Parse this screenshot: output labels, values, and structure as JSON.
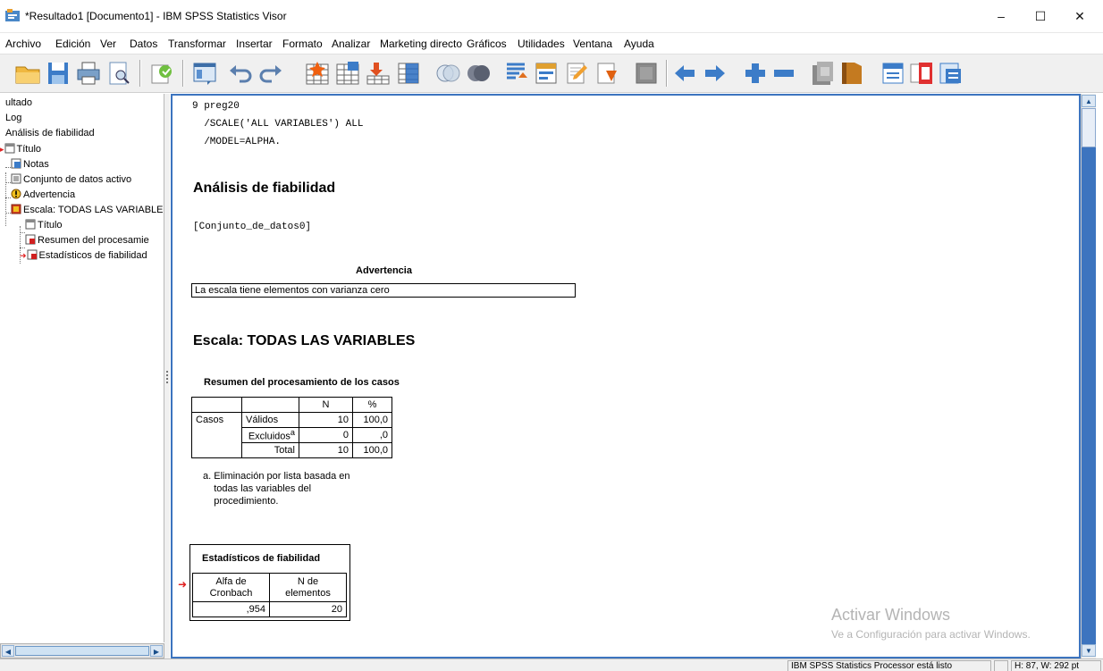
{
  "window": {
    "title": "*Resultado1 [Documento1] - IBM SPSS Statistics Visor",
    "min_glyph": "–",
    "max_glyph": "☐",
    "close_glyph": "✕"
  },
  "menu": [
    "Archivo",
    "Edición",
    "Ver",
    "Datos",
    "Transformar",
    "Insertar",
    "Formato",
    "Analizar",
    "Marketing directo",
    "Gráficos",
    "Utilidades",
    "Ventana",
    "Ayuda"
  ],
  "toolbar_icons": [
    "open-icon",
    "save-icon",
    "print-icon",
    "print-preview-icon",
    "export-icon",
    "recall-dialog-icon",
    "undo-icon",
    "redo-icon",
    "goto-data-icon",
    "goto-case-icon",
    "variables-icon",
    "select-cases-icon",
    "circle-icon",
    "circles-icon",
    "weight-icon",
    "value-labels-icon",
    "designate-window-icon",
    "show-output-icon",
    "hidden-icon",
    "promote-icon",
    "demote-icon",
    "expand-icon",
    "collapse-icon",
    "show-icon",
    "hide-icon",
    "insert-heading-icon",
    "insert-title-icon",
    "insert-text-icon"
  ],
  "outline": {
    "items": [
      "ultado",
      "Log",
      "Análisis de fiabilidad",
      "Título",
      "Notas",
      "Conjunto de datos activo",
      "Advertencia",
      "Escala: TODAS LAS VARIABLE",
      "Título",
      "Resumen del procesamie",
      "Estadísticos de fiabilidad"
    ]
  },
  "syntax": {
    "line1": "9 preg20",
    "line2": "  /SCALE('ALL VARIABLES') ALL",
    "line3": "  /MODEL=ALPHA."
  },
  "output": {
    "heading1": "Análisis de fiabilidad",
    "dataset": "[Conjunto_de_datos0]",
    "warning_title": "Advertencia",
    "warning_text": "La escala tiene elementos con varianza cero",
    "heading2": "Escala: TODAS LAS VARIABLES",
    "summary": {
      "caption": "Resumen del procesamiento de los casos",
      "col_n": "N",
      "col_pct": "%",
      "row_group": "Casos",
      "rows": [
        {
          "label": "Válidos",
          "n": "10",
          "pct": "100,0"
        },
        {
          "label": "Excluidos",
          "n": "0",
          "pct": ",0"
        },
        {
          "label": "Total",
          "n": "10",
          "pct": "100,0"
        }
      ],
      "superscript": "a",
      "footnote": "a. Eliminación por lista basada en\n    todas las variables del\n    procedimiento."
    },
    "reliability": {
      "caption": "Estadísticos de fiabilidad",
      "col1_line1": "Alfa de",
      "col1_line2": "Cronbach",
      "col2_line1": "N de",
      "col2_line2": "elementos",
      "alpha": ",954",
      "n_items": "20"
    }
  },
  "watermark": {
    "title": "Activar Windows",
    "subtitle": "Ve a Configuración para activar Windows."
  },
  "status": {
    "processor": "IBM SPSS Statistics Processor está listo",
    "size": "H: 87, W: 292 pt"
  },
  "colors": {
    "accent_blue": "#3c74bf",
    "arrow_red": "#e02020"
  }
}
